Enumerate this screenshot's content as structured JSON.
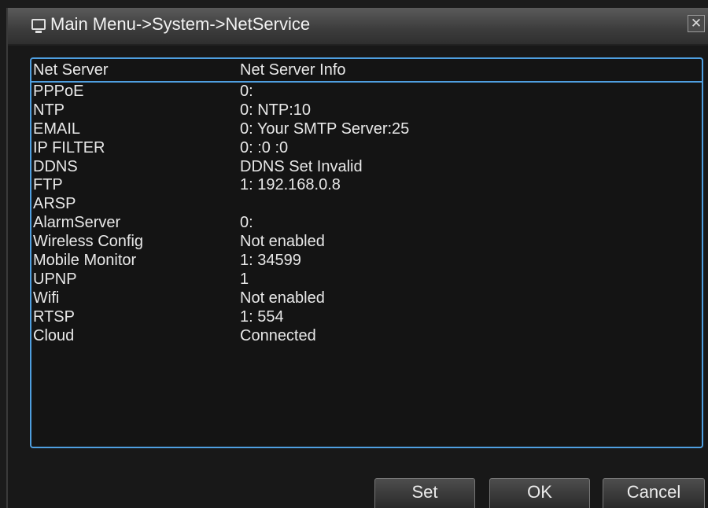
{
  "window": {
    "title": "Main Menu->System->NetService",
    "close_label": "✕"
  },
  "table": {
    "headers": [
      "Net Server",
      "Net Server Info"
    ],
    "rows": [
      {
        "server": "PPPoE",
        "info": "0:"
      },
      {
        "server": "NTP",
        "info": "0: NTP:10"
      },
      {
        "server": "EMAIL",
        "info": "0: Your SMTP Server:25"
      },
      {
        "server": "IP FILTER",
        "info": "0: :0 :0"
      },
      {
        "server": "DDNS",
        "info": "DDNS Set Invalid"
      },
      {
        "server": "FTP",
        "info": "1: 192.168.0.8"
      },
      {
        "server": "ARSP",
        "info": ""
      },
      {
        "server": "AlarmServer",
        "info": "0:"
      },
      {
        "server": "Wireless Config",
        "info": "Not enabled"
      },
      {
        "server": "Mobile Monitor",
        "info": "1: 34599"
      },
      {
        "server": "UPNP",
        "info": "1"
      },
      {
        "server": "Wifi",
        "info": "Not enabled"
      },
      {
        "server": "RTSP",
        "info": "1: 554"
      },
      {
        "server": "Cloud",
        "info": "Connected"
      }
    ]
  },
  "buttons": {
    "set": "Set",
    "ok": "OK",
    "cancel": "Cancel"
  }
}
